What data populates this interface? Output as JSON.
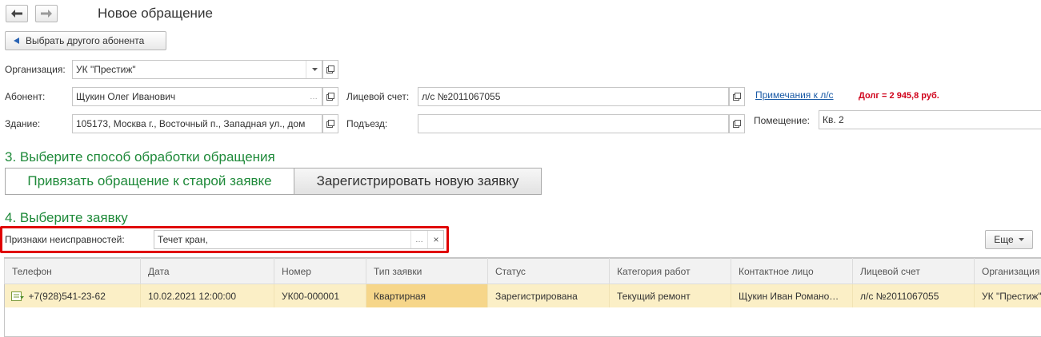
{
  "window": {
    "title": "Новое обращение"
  },
  "nav": {
    "back_icon": "arrow-left-icon",
    "forward_icon": "arrow-right-icon"
  },
  "choose_other": {
    "label": "Выбрать другого абонента",
    "icon": "triangle-left-icon"
  },
  "form": {
    "org_label": "Организация:",
    "org_value": "УК \"Престиж\"",
    "subscriber_label": "Абонент:",
    "subscriber_value": "Щукин Олег Иванович",
    "account_label": "Лицевой счет:",
    "account_value": "л/с №2011067055",
    "notes_link": "Примечания к л/с",
    "debt": "Долг = 2 945,8 руб.",
    "building_label": "Здание:",
    "building_value": "105173, Москва г., Восточный п., Западная ул., дом",
    "entrance_label": "Подъезд:",
    "entrance_value": "",
    "room_label": "Помещение:",
    "room_value": "Кв. 2"
  },
  "step3": {
    "heading": "3. Выберите способ обработки обращения",
    "btn_link_old": "Привязать обращение к старой заявке",
    "btn_register_new": "Зарегистрировать новую заявку"
  },
  "step4": {
    "heading": "4. Выберите заявку",
    "symptoms_label": "Признаки неисправностей:",
    "symptoms_value": "Течет кран,",
    "more_label": "Еще"
  },
  "table": {
    "columns": [
      "Телефон",
      "Дата",
      "Номер",
      "Тип заявки",
      "Статус",
      "Категория работ",
      "Контактное лицо",
      "Лицевой счет",
      "Организация"
    ],
    "rows": [
      [
        "+7(928)541-23-62",
        "10.02.2021 12:00:00",
        "УК00-000001",
        "Квартирная",
        "Зарегистрирована",
        "Текущий ремонт",
        "Щукин Иван Романо…",
        "л/с №2011067055",
        "УК \"Престиж\""
      ]
    ]
  },
  "colors": {
    "accent_green": "#1f8a3a",
    "debt_red": "#d0021b",
    "link_blue": "#1a5aa6",
    "highlight_red": "#e00000",
    "row_yellow": "#fbefc6"
  }
}
